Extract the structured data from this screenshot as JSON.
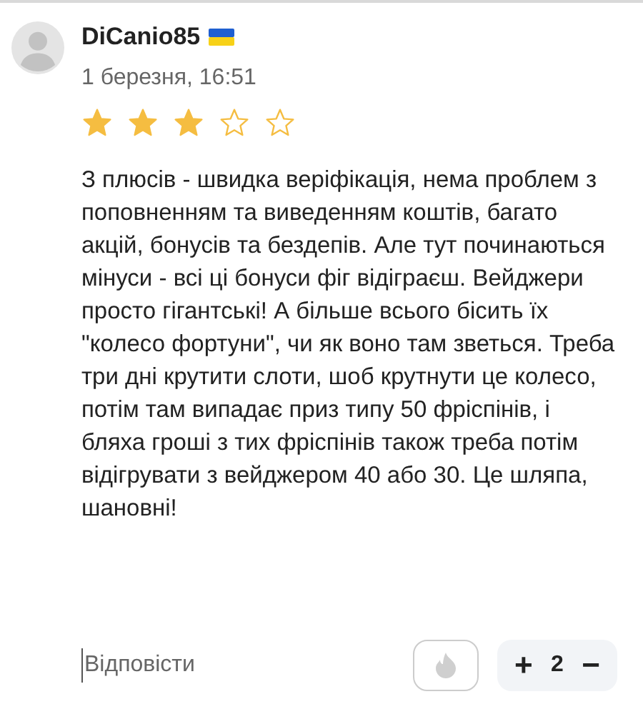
{
  "author": {
    "name": "DiCanio85",
    "date": "1 березня, 16:51"
  },
  "rating": {
    "stars": 3
  },
  "text": "З плюсів - швидка веріфікація, нема проблем з поповненням та виведенням коштів, багато акцій, бонусів та бездепів. Але тут починаються мінуси - всі ці бонуси фіг відіграєш. Вейджери просто гігантські! А більше всього бісить їх \"колесо фортуни\", чи як воно там зветься. Треба три дні крутити слоти, шоб крутнути це колесо, потім там випадає приз типу 50 фріспінів, і бляха гроші з тих фріспінів також треба потім відігрувати з вейджером 40 або 30. Це шляпа, шановні!",
  "actions": {
    "reply": "Відповісти",
    "plus": "+",
    "count": "2",
    "minus": "−"
  }
}
